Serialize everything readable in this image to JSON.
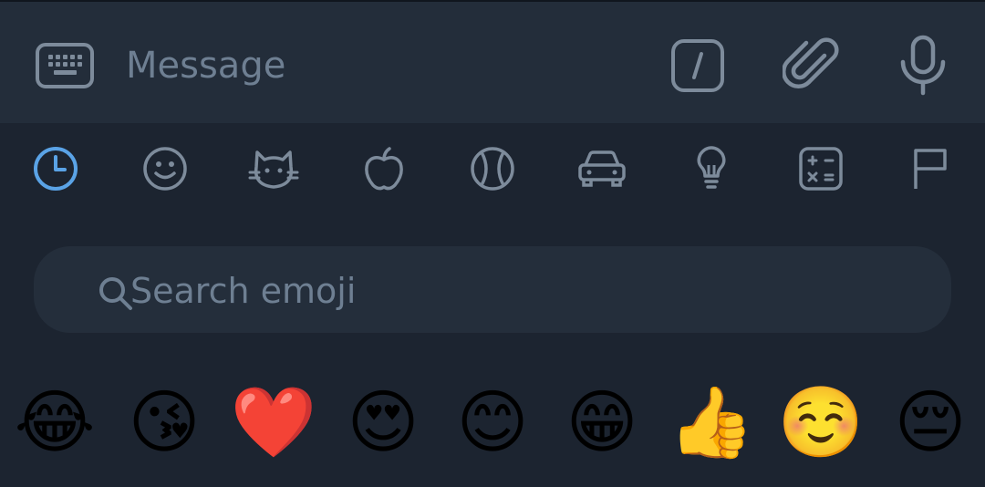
{
  "input_bar": {
    "placeholder": "Message",
    "icons": [
      "keyboard-icon",
      "slash-command-icon",
      "paperclip-icon",
      "microphone-icon"
    ]
  },
  "categories": [
    {
      "name": "recent",
      "icon": "clock-icon",
      "active": true
    },
    {
      "name": "smileys",
      "icon": "smiley-icon",
      "active": false
    },
    {
      "name": "animals",
      "icon": "cat-icon",
      "active": false
    },
    {
      "name": "food",
      "icon": "apple-icon",
      "active": false
    },
    {
      "name": "activity",
      "icon": "ball-icon",
      "active": false
    },
    {
      "name": "travel",
      "icon": "car-icon",
      "active": false
    },
    {
      "name": "objects",
      "icon": "lightbulb-icon",
      "active": false
    },
    {
      "name": "symbols",
      "icon": "calculator-icon",
      "active": false
    },
    {
      "name": "flags",
      "icon": "flag-icon",
      "active": false
    }
  ],
  "search": {
    "placeholder": "Search emoji"
  },
  "recent_emojis": [
    "😂",
    "😘",
    "❤️",
    "😍",
    "😊",
    "😁",
    "👍",
    "☺️",
    "😔"
  ],
  "colors": {
    "background": "#1c2430",
    "input_bar": "#232d3a",
    "search_bg": "#242e3b",
    "icon": "#7d8b9b",
    "accent": "#5aa3e6",
    "muted_text": "#6e7f92"
  }
}
